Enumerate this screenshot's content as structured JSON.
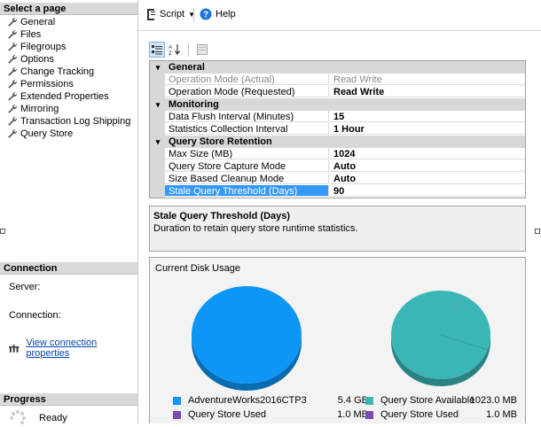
{
  "left_pane": {
    "select_page": {
      "heading": "Select a page",
      "items": [
        {
          "label": "General"
        },
        {
          "label": "Files"
        },
        {
          "label": "Filegroups"
        },
        {
          "label": "Options"
        },
        {
          "label": "Change Tracking"
        },
        {
          "label": "Permissions"
        },
        {
          "label": "Extended Properties"
        },
        {
          "label": "Mirroring"
        },
        {
          "label": "Transaction Log Shipping"
        },
        {
          "label": "Query Store",
          "selected": true
        }
      ]
    },
    "connection": {
      "heading": "Connection",
      "server_label": "Server:",
      "connection_label": "Connection:",
      "view_link": "View connection properties"
    },
    "progress": {
      "heading": "Progress",
      "status": "Ready"
    }
  },
  "toolbar": {
    "script_label": "Script",
    "help_label": "Help"
  },
  "properties": {
    "categories": [
      {
        "name": "General",
        "rows": [
          {
            "name": "Operation Mode (Actual)",
            "value": "Read Write",
            "readonly": true
          },
          {
            "name": "Operation Mode (Requested)",
            "value": "Read Write"
          }
        ]
      },
      {
        "name": "Monitoring",
        "rows": [
          {
            "name": "Data Flush Interval (Minutes)",
            "value": "15"
          },
          {
            "name": "Statistics Collection Interval",
            "value": "1 Hour"
          }
        ]
      },
      {
        "name": "Query Store Retention",
        "rows": [
          {
            "name": "Max Size (MB)",
            "value": "1024"
          },
          {
            "name": "Query Store Capture Mode",
            "value": "Auto"
          },
          {
            "name": "Size Based Cleanup Mode",
            "value": "Auto"
          },
          {
            "name": "Stale Query Threshold (Days)",
            "value": "90",
            "selected": true
          }
        ]
      }
    ]
  },
  "description": {
    "title": "Stale Query Threshold (Days)",
    "text": "Duration to retain query store runtime statistics."
  },
  "disk_usage": {
    "title": "Current Disk Usage",
    "charts": [
      {
        "slices": [
          {
            "label": "AdventureWorks2016CTP3",
            "value": "5.4 GB",
            "color": "#0d96f6",
            "fraction": 0.9998
          },
          {
            "label": "Query Store Used",
            "value": "1.0 MB",
            "color": "#7b4bb3",
            "fraction": 0.0002
          }
        ]
      },
      {
        "slices": [
          {
            "label": "Query Store Available",
            "value": "1023.0 MB",
            "color": "#3bb6b6",
            "fraction": 0.999
          },
          {
            "label": "Query Store Used",
            "value": "1.0 MB",
            "color": "#7b4bb3",
            "fraction": 0.001
          }
        ]
      }
    ]
  },
  "colors": {
    "accent": "#3399ff",
    "pie_blue": "#0d96f6",
    "pie_teal": "#3bb6b6",
    "pie_purple": "#7b4bb3"
  }
}
